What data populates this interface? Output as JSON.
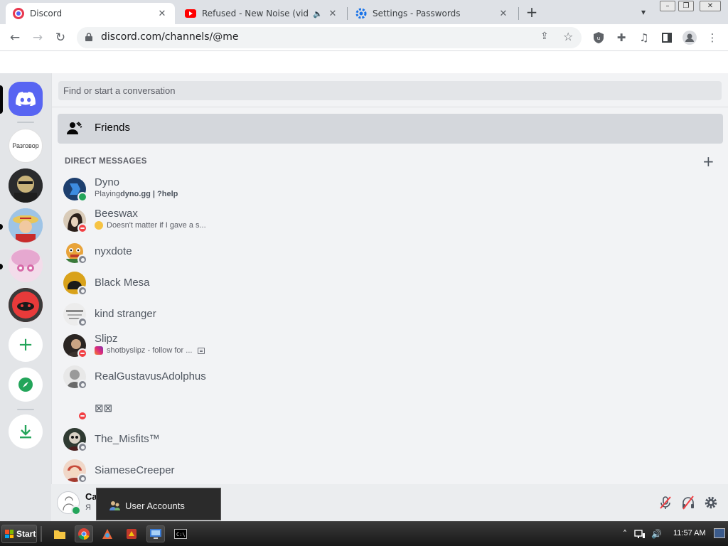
{
  "browser": {
    "tabs": [
      {
        "title": "Discord",
        "active": true,
        "favicon": "discord-favicon"
      },
      {
        "title": "Refused - New Noise (video)",
        "active": false,
        "favicon": "youtube-favicon",
        "audio": "speaker-icon"
      },
      {
        "title": "Settings - Passwords",
        "active": false,
        "favicon": "settings-gear-favicon"
      }
    ],
    "close_glyph": "✕",
    "new_tab_glyph": "+",
    "url": "discord.com/channels/@me"
  },
  "discord": {
    "search_placeholder": "Find or start a conversation",
    "friends_label": "Friends",
    "dm_header": "DIRECT MESSAGES",
    "add_dm_glyph": "+",
    "servers": [
      {
        "label": "Разговор"
      }
    ],
    "dms": [
      {
        "name": "Dyno",
        "status": "online",
        "sub_prefix": "Playing ",
        "sub_bold": "dyno.gg | ?help"
      },
      {
        "name": "Beeswax",
        "status": "dnd",
        "sub_text": "Doesn't matter if I gave a s..."
      },
      {
        "name": "nyxdote",
        "status": "offline"
      },
      {
        "name": "Black Mesa",
        "status": "offline"
      },
      {
        "name": "kind stranger",
        "status": "offline"
      },
      {
        "name": "Slipz",
        "status": "dnd",
        "sub_text": "shotbyslipz - follow for ..."
      },
      {
        "name": "RealGustavusAdolphus",
        "status": "offline"
      },
      {
        "name": "⊠⊠",
        "status": "dnd"
      },
      {
        "name": "The_Misfits™",
        "status": "offline"
      },
      {
        "name": "SiameseCreeper",
        "status": "offline"
      }
    ],
    "user_panel": {
      "name": "Ca",
      "sub": "Я"
    }
  },
  "tooltip": {
    "label": "User Accounts"
  },
  "taskbar": {
    "start_label": "Start",
    "clock": "11:57 AM"
  },
  "colors": {
    "discord_blurple": "#5865f2",
    "online": "#23a55a",
    "dnd": "#f23f43",
    "offline": "#80848e"
  }
}
